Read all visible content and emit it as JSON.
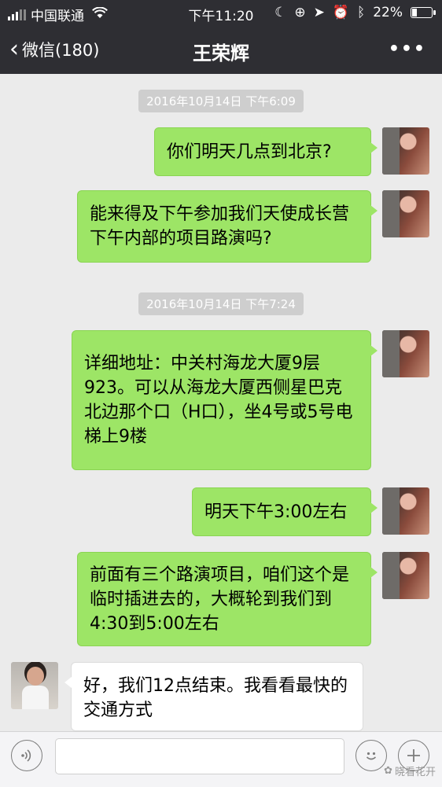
{
  "status_bar": {
    "carrier": "中国联通",
    "time": "下午11:20",
    "battery": "22%",
    "battery_level": 0.22,
    "icons": [
      "signal-icon",
      "wifi-icon",
      "moon-icon",
      "lock-rotation-icon",
      "location-icon",
      "alarm-icon",
      "bluetooth-icon",
      "battery-icon"
    ]
  },
  "nav": {
    "back_label": "微信(180)",
    "title": "王荣辉",
    "more_label": "•••"
  },
  "chat": {
    "timestamps": [
      "2016年10月14日 下午6:09",
      "2016年10月14日 下午7:24"
    ],
    "messages": [
      {
        "from": "me",
        "text": "你们明天几点到北京?"
      },
      {
        "from": "me",
        "text": "能来得及下午参加我们天使成长营下午内部的项目路演吗?"
      },
      {
        "from": "me",
        "text": "详细地址：中关村海龙大厦9层923。可以从海龙大厦西侧星巴克北边那个口（H口），坐4号或5号电梯上9楼"
      },
      {
        "from": "me",
        "text": "明天下午3:00左右"
      },
      {
        "from": "me",
        "text": "前面有三个路演项目，咱们这个是临时插进去的，大概轮到我们到4:30到5:00左右"
      },
      {
        "from": "them",
        "text": "好，我们12点结束。我看看最快的交通方式"
      }
    ]
  },
  "input_bar": {
    "voice_icon": "voice-icon",
    "emoji_icon": "emoji-icon",
    "plus_icon": "plus-icon"
  },
  "watermark": "晓看花开",
  "colors": {
    "header_bg": "#2e2e33",
    "chat_bg": "#ebebeb",
    "my_bubble": "#9de566",
    "their_bubble": "#ffffff"
  }
}
